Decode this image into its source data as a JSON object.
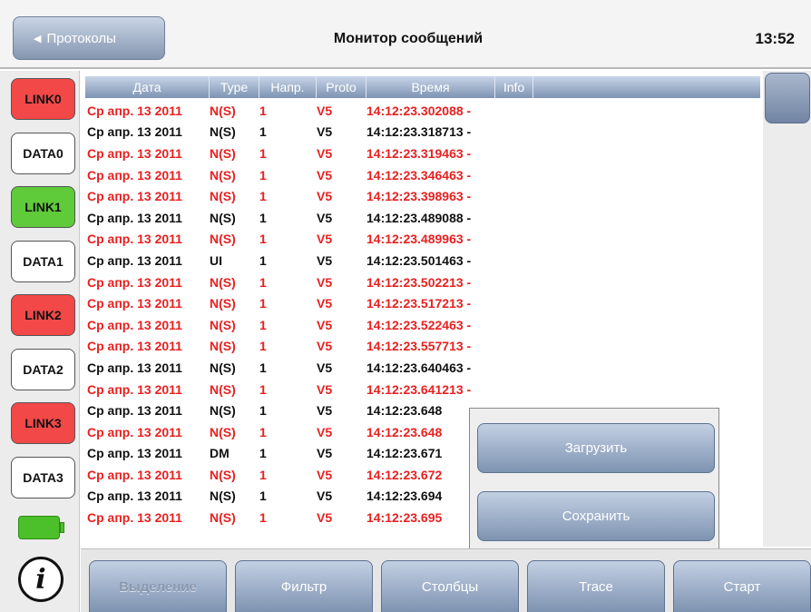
{
  "header": {
    "back_label": "Протоколы",
    "title": "Монитор сообщений",
    "clock": "13:52"
  },
  "side": {
    "buttons": [
      {
        "label": "LINK0",
        "state": "red"
      },
      {
        "label": "DATA0",
        "state": "white"
      },
      {
        "label": "LINK1",
        "state": "green"
      },
      {
        "label": "DATA1",
        "state": "white"
      },
      {
        "label": "LINK2",
        "state": "red"
      },
      {
        "label": "DATA2",
        "state": "white"
      },
      {
        "label": "LINK3",
        "state": "red"
      },
      {
        "label": "DATA3",
        "state": "white"
      }
    ],
    "battery_icon": "battery-full-icon",
    "info_glyph": "i"
  },
  "table": {
    "columns": [
      "Дата",
      "Type",
      "Напр.",
      "Proto",
      "Время",
      "Info"
    ],
    "rows": [
      {
        "date": "Ср апр. 13 2011",
        "type": "N(S)",
        "dir": "1",
        "proto": "V5",
        "time": "14:12:23.302088 -",
        "color": "red"
      },
      {
        "date": "Ср апр. 13 2011",
        "type": "N(S)",
        "dir": "1",
        "proto": "V5",
        "time": "14:12:23.318713 -",
        "color": "black"
      },
      {
        "date": "Ср апр. 13 2011",
        "type": "N(S)",
        "dir": "1",
        "proto": "V5",
        "time": "14:12:23.319463 -",
        "color": "red"
      },
      {
        "date": "Ср апр. 13 2011",
        "type": "N(S)",
        "dir": "1",
        "proto": "V5",
        "time": "14:12:23.346463 -",
        "color": "red"
      },
      {
        "date": "Ср апр. 13 2011",
        "type": "N(S)",
        "dir": "1",
        "proto": "V5",
        "time": "14:12:23.398963 -",
        "color": "red"
      },
      {
        "date": "Ср апр. 13 2011",
        "type": "N(S)",
        "dir": "1",
        "proto": "V5",
        "time": "14:12:23.489088 -",
        "color": "black"
      },
      {
        "date": "Ср апр. 13 2011",
        "type": "N(S)",
        "dir": "1",
        "proto": "V5",
        "time": "14:12:23.489963 -",
        "color": "red"
      },
      {
        "date": "Ср апр. 13 2011",
        "type": "UI",
        "dir": "1",
        "proto": "V5",
        "time": "14:12:23.501463 -",
        "color": "black"
      },
      {
        "date": "Ср апр. 13 2011",
        "type": "N(S)",
        "dir": "1",
        "proto": "V5",
        "time": "14:12:23.502213 -",
        "color": "red"
      },
      {
        "date": "Ср апр. 13 2011",
        "type": "N(S)",
        "dir": "1",
        "proto": "V5",
        "time": "14:12:23.517213 -",
        "color": "red"
      },
      {
        "date": "Ср апр. 13 2011",
        "type": "N(S)",
        "dir": "1",
        "proto": "V5",
        "time": "14:12:23.522463 -",
        "color": "red"
      },
      {
        "date": "Ср апр. 13 2011",
        "type": "N(S)",
        "dir": "1",
        "proto": "V5",
        "time": "14:12:23.557713 -",
        "color": "red"
      },
      {
        "date": "Ср апр. 13 2011",
        "type": "N(S)",
        "dir": "1",
        "proto": "V5",
        "time": "14:12:23.640463 -",
        "color": "black"
      },
      {
        "date": "Ср апр. 13 2011",
        "type": "N(S)",
        "dir": "1",
        "proto": "V5",
        "time": "14:12:23.641213 -",
        "color": "red"
      },
      {
        "date": "Ср апр. 13 2011",
        "type": "N(S)",
        "dir": "1",
        "proto": "V5",
        "time": "14:12:23.648",
        "color": "black"
      },
      {
        "date": "Ср апр. 13 2011",
        "type": "N(S)",
        "dir": "1",
        "proto": "V5",
        "time": "14:12:23.648",
        "color": "red"
      },
      {
        "date": "Ср апр. 13 2011",
        "type": "DM",
        "dir": "1",
        "proto": "V5",
        "time": "14:12:23.671",
        "color": "black"
      },
      {
        "date": "Ср апр. 13 2011",
        "type": "N(S)",
        "dir": "1",
        "proto": "V5",
        "time": "14:12:23.672",
        "color": "red"
      },
      {
        "date": "Ср апр. 13 2011",
        "type": "N(S)",
        "dir": "1",
        "proto": "V5",
        "time": "14:12:23.694",
        "color": "black"
      },
      {
        "date": "Ср апр. 13 2011",
        "type": "N(S)",
        "dir": "1",
        "proto": "V5",
        "time": "14:12:23.695",
        "color": "red"
      }
    ]
  },
  "popup": {
    "load_label": "Загрузить",
    "save_label": "Сохранить"
  },
  "toolbar": {
    "select_label": "Выделение",
    "filter_label": "Фильтр",
    "columns_label": "Столбцы",
    "trace_label": "Trace",
    "start_label": "Старт"
  },
  "colors": {
    "red_row": "#e82020",
    "link_red": "#f24848",
    "link_green": "#5fcb3b",
    "button_blue": "#7e93b1"
  }
}
